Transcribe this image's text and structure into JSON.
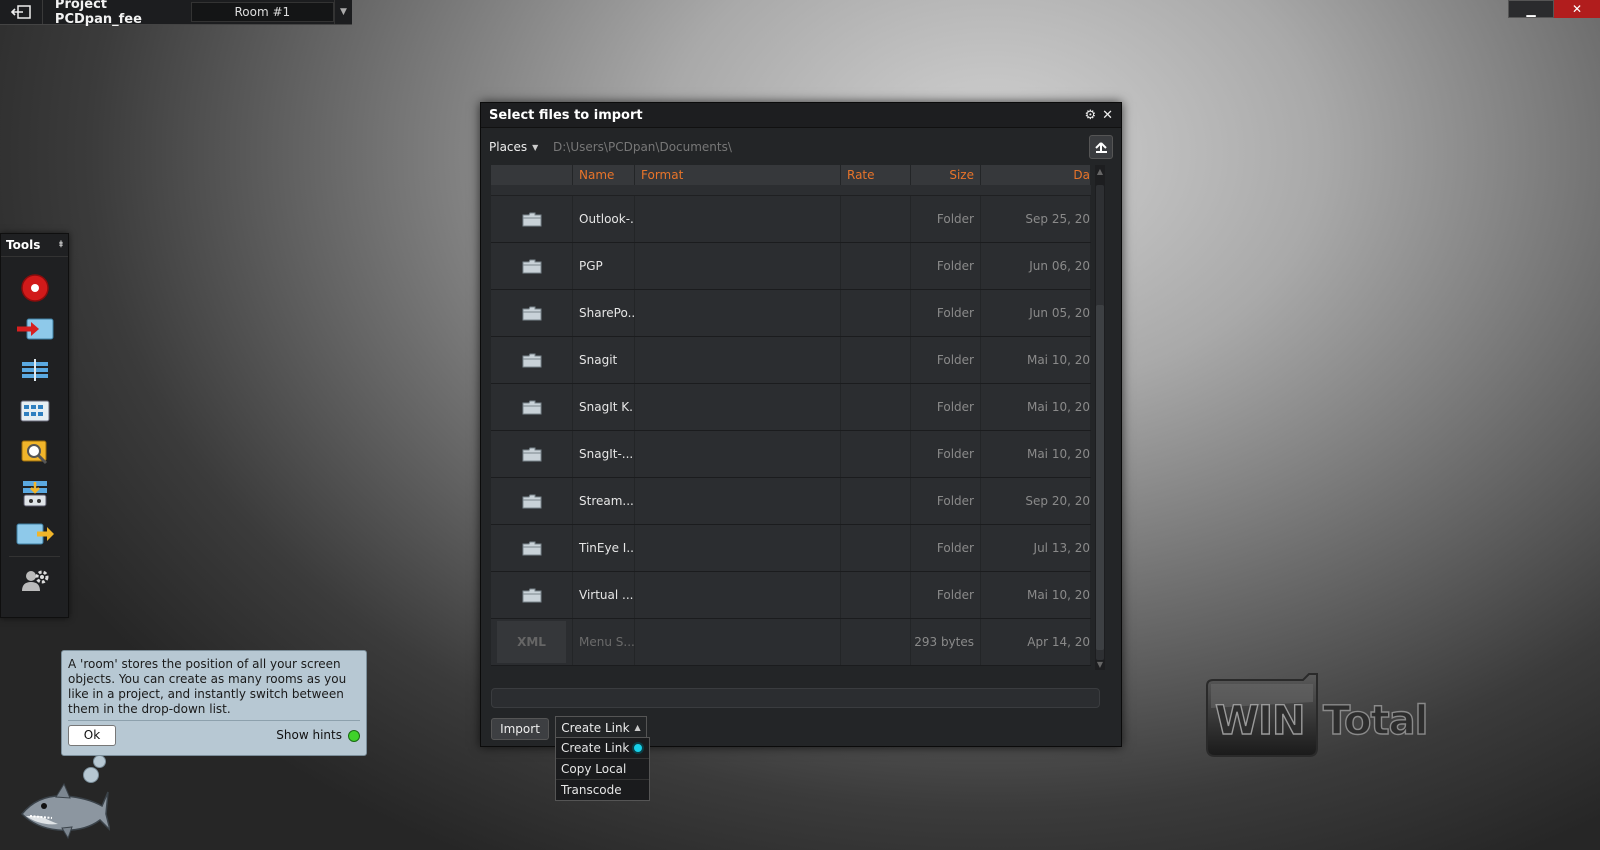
{
  "topbar": {
    "exit_icon": "exit-arrow-icon",
    "project_title": "Project PCDpan_fee",
    "room_selected": "Room #1"
  },
  "window_controls": {
    "minimize_icon": "minimize-icon",
    "close_icon": "close-icon"
  },
  "tools": {
    "title": "Tools",
    "items": [
      {
        "name": "record-icon"
      },
      {
        "name": "import-media-icon"
      },
      {
        "name": "timeline-icon"
      },
      {
        "name": "grid-view-icon"
      },
      {
        "name": "search-browser-icon"
      },
      {
        "name": "render-queue-icon"
      },
      {
        "name": "export-icon"
      },
      {
        "name": "user-settings-icon"
      }
    ]
  },
  "hint": {
    "text": "A 'room' stores the position of all your screen objects.  You can create as many rooms as you like in a project, and instantly switch between them in the drop-down list.",
    "ok_label": "Ok",
    "show_hints_label": "Show hints"
  },
  "dialog": {
    "title": "Select files to import",
    "places_label": "Places",
    "path": "D:\\Users\\PCDpan\\Documents\\",
    "columns": {
      "name": "Name",
      "format": "Format",
      "rate": "Rate",
      "size": "Size",
      "date": "Da"
    },
    "rows": [
      {
        "name": "Outlook-...",
        "size": "Folder",
        "date": "Sep 25, 20"
      },
      {
        "name": "PGP",
        "size": "Folder",
        "date": "Jun 06, 20"
      },
      {
        "name": "SharePo...",
        "size": "Folder",
        "date": "Jun 05, 20"
      },
      {
        "name": "Snagit",
        "size": "Folder",
        "date": "Mai 10, 20"
      },
      {
        "name": "SnagIt K...",
        "size": "Folder",
        "date": "Mai 10, 20"
      },
      {
        "name": "SnagIt-...",
        "size": "Folder",
        "date": "Mai 10, 20"
      },
      {
        "name": "Stream...",
        "size": "Folder",
        "date": "Sep 20, 20"
      },
      {
        "name": "TinEye I...",
        "size": "Folder",
        "date": "Jul 13, 20"
      },
      {
        "name": "Virtual ...",
        "size": "Folder",
        "date": "Mai 10, 20"
      }
    ],
    "xml_row": {
      "badge": "XML",
      "name": "Menu S...",
      "size": "293 bytes",
      "date": "Apr 14, 20"
    },
    "import_label": "Import",
    "mode_label": "Create Link",
    "mode_options": [
      {
        "label": "Create Link",
        "selected": true
      },
      {
        "label": "Copy Local",
        "selected": false
      },
      {
        "label": "Transcode",
        "selected": false
      }
    ]
  },
  "colors": {
    "accent_orange": "#e8742a",
    "radio_cyan": "#18d0e8",
    "close_red": "#b11d1d"
  }
}
